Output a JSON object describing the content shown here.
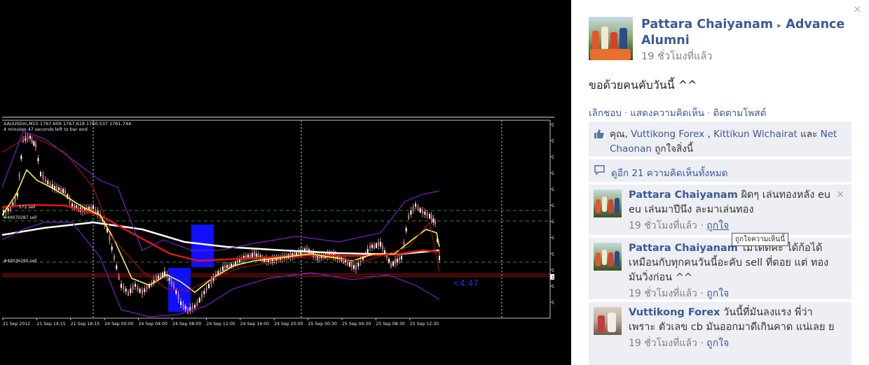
{
  "chart": {
    "header_line1": "XAUUSDm,M15  1767.609 1767.618 1760.537 1761.744",
    "header_line2": "4 minutes 47 seconds left to bar end",
    "countdown": "<4:47",
    "current_price": "1761.74",
    "price_labels": [
      "1788.26",
      "1785.20",
      "1782.15",
      "1779.11",
      "1776.11",
      "1773.05",
      "1770.08",
      "1767.02",
      "1763.96",
      "1760.95",
      "1757.93",
      "1754.96"
    ],
    "time_labels": [
      "21 Sep 2012",
      "21 Sep 14:15",
      "21 Sep 18:15",
      "24 Sep 00:00",
      "24 Sep 04:00",
      "24 Sep 08:00",
      "24 Sep 12:00",
      "24 Sep 16:00",
      "24 Sep 20:00",
      "25 Sep 00:30",
      "25 Sep 04:30",
      "25 Sep 08:30",
      "25 Sep 12:30"
    ],
    "order_labels": [
      "#49070287 sell",
      "#49036290 sell",
      "572 sell"
    ],
    "colors": {
      "background": "#000000",
      "bollinger": "#7a1ec8",
      "ma_fast": "#ffff40",
      "ma_mid": "#e31414",
      "ma_slow": "#ffffff",
      "box": "#1010ff",
      "order_line": "#2e8b2e"
    }
  },
  "post": {
    "author": "Pattara Chaiyanam",
    "arrow": "▸",
    "group": "Advance Alumni",
    "time": "19 ชั่วโมงที่แล้ว",
    "text": "ขอด้วยคนคับวันนี้ ^^",
    "actions": [
      "เลิกชอบ",
      "แสดงความคิดเห็น",
      "ติดตามโพสต์"
    ],
    "likes": {
      "you": "คุณ,",
      "people": [
        "Vuttikong Forex",
        "Kittikun Wichairat"
      ],
      "sep1": " , ",
      "and": " และ ",
      "last": "Net Chaonan",
      "suffix": " ถูกใจสิ่งนี้"
    },
    "view_all": "ดูอีก 21 ความคิดเห็นทั้งหมด"
  },
  "comments": [
    {
      "author": "Pattara Chaiyanam",
      "text": "ผิดๆ เล่นทองหลัง eu eu เล่นมาปีนึง ละมาเล่นทอง",
      "time": "19 ชั่วโมงที่แล้ว",
      "like": "ถูกใจ",
      "delete": "×"
    },
    {
      "author": "Pattara Chaiyanam",
      "text": "ไม่ได้ดิค่ะ ได้ก้อได้ เหมือนกับทุกคนวันนี้อะคับ sell ที่ดอย แต่ ทองมันวิ่งก่อน ^^",
      "time": "19 ชั่วโมงที่แล้ว",
      "like": "ถูกใจ"
    },
    {
      "author": "Vuttikong Forex",
      "text": "วันนี้ที่มันลงแรง พี่ว่า เพราะ ตัวเลข cb มันออกมาดีเกินคาด แน่เลย ย",
      "time": "19 ชั่วโมงที่แล้ว",
      "like": "ถูกใจ"
    }
  ],
  "tooltip": "ถูกใจความเห็นนี้",
  "close_icon": "×",
  "middot": "·"
}
